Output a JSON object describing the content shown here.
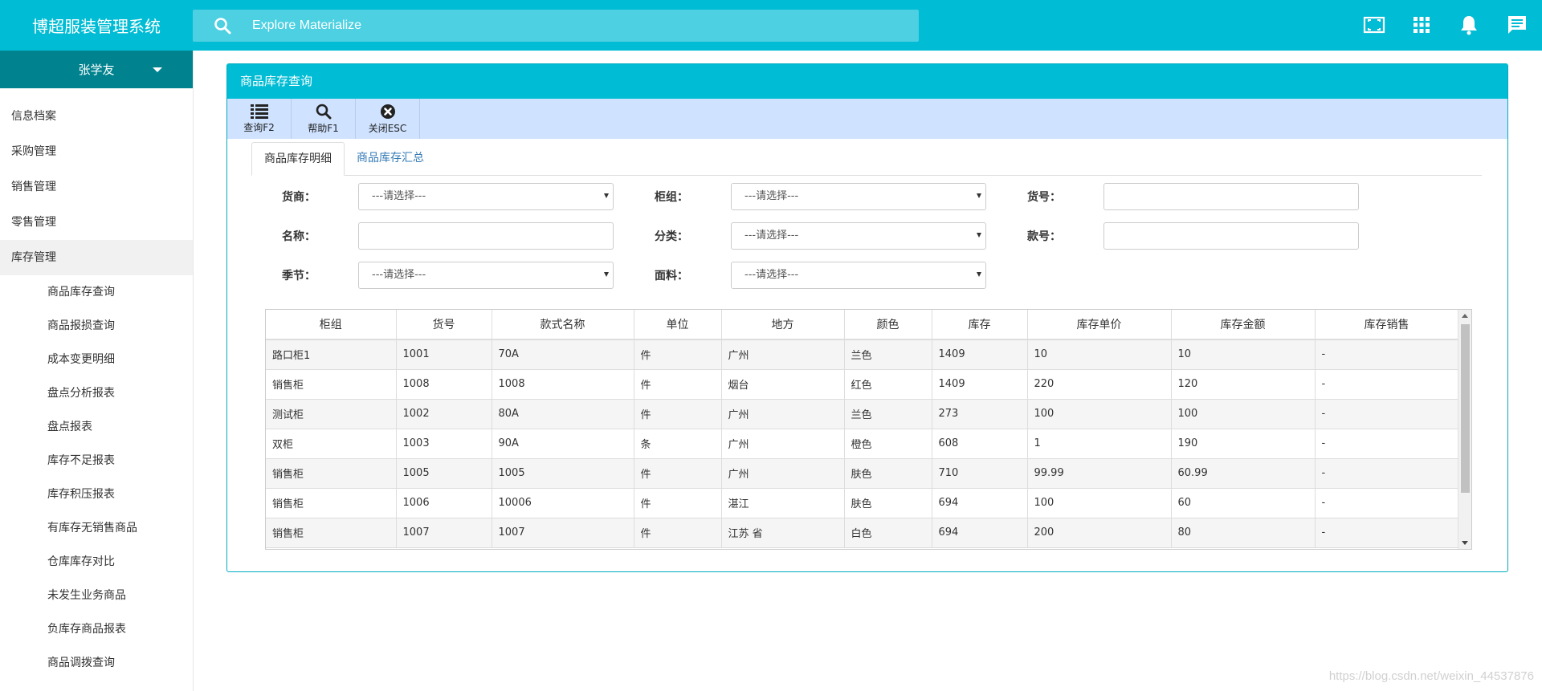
{
  "app": {
    "title": "博超服装管理系统"
  },
  "search": {
    "placeholder": "Explore Materialize"
  },
  "header_icons": [
    "fullscreen-icon",
    "apps-grid-icon",
    "bell-icon",
    "message-icon"
  ],
  "user": {
    "name": "张学友"
  },
  "sidebar": {
    "items": [
      {
        "label": "信息档案"
      },
      {
        "label": "采购管理"
      },
      {
        "label": "销售管理"
      },
      {
        "label": "零售管理"
      },
      {
        "label": "库存管理"
      }
    ],
    "subitems": [
      {
        "label": "商品库存查询"
      },
      {
        "label": "商品报损查询"
      },
      {
        "label": "成本变更明细"
      },
      {
        "label": "盘点分析报表"
      },
      {
        "label": "盘点报表"
      },
      {
        "label": "库存不足报表"
      },
      {
        "label": "库存积压报表"
      },
      {
        "label": "有库存无销售商品"
      },
      {
        "label": "仓库库存对比"
      },
      {
        "label": "未发生业务商品"
      },
      {
        "label": "负库存商品报表"
      },
      {
        "label": "商品调拨查询"
      }
    ]
  },
  "panel": {
    "title": "商品库存查询"
  },
  "toolbar": {
    "query": "查询F2",
    "help": "帮助F1",
    "close": "关闭ESC"
  },
  "tabs": [
    {
      "label": "商品库存明细"
    },
    {
      "label": "商品库存汇总"
    }
  ],
  "form": {
    "supplier_label": "货商：",
    "counter_label": "柜组：",
    "item_no_label": "货号：",
    "name_label": "名称：",
    "category_label": "分类：",
    "style_no_label": "款号：",
    "season_label": "季节：",
    "fabric_label": "面料：",
    "select_placeholder": "---请选择---",
    "supplier_value": "",
    "item_no_value": "",
    "name_value": "",
    "style_no_value": ""
  },
  "table": {
    "columns": [
      "柜组",
      "货号",
      "款式名称",
      "单位",
      "地方",
      "颜色",
      "库存",
      "库存单价",
      "库存金额",
      "库存销售"
    ],
    "rows": [
      [
        "路口柜1",
        "1001",
        "70A",
        "件",
        "广州",
        "兰色",
        "1409",
        "10",
        "10",
        "-"
      ],
      [
        "销售柜",
        "1008",
        "1008",
        "件",
        "烟台",
        "红色",
        "1409",
        "220",
        "120",
        "-"
      ],
      [
        "测试柜",
        "1002",
        "80A",
        "件",
        "广州",
        "兰色",
        "273",
        "100",
        "100",
        "-"
      ],
      [
        "双柜",
        "1003",
        "90A",
        "条",
        "广州",
        "橙色",
        "608",
        "1",
        "190",
        "-"
      ],
      [
        "销售柜",
        "1005",
        "1005",
        "件",
        "广州",
        "肤色",
        "710",
        "99.99",
        "60.99",
        "-"
      ],
      [
        "销售柜",
        "1006",
        "10006",
        "件",
        "湛江",
        "肤色",
        "694",
        "100",
        "60",
        "-"
      ],
      [
        "销售柜",
        "1007",
        "1007",
        "件",
        "江苏 省",
        "白色",
        "694",
        "200",
        "80",
        "-"
      ]
    ]
  },
  "watermark": "https://blog.csdn.net/weixin_44537876"
}
